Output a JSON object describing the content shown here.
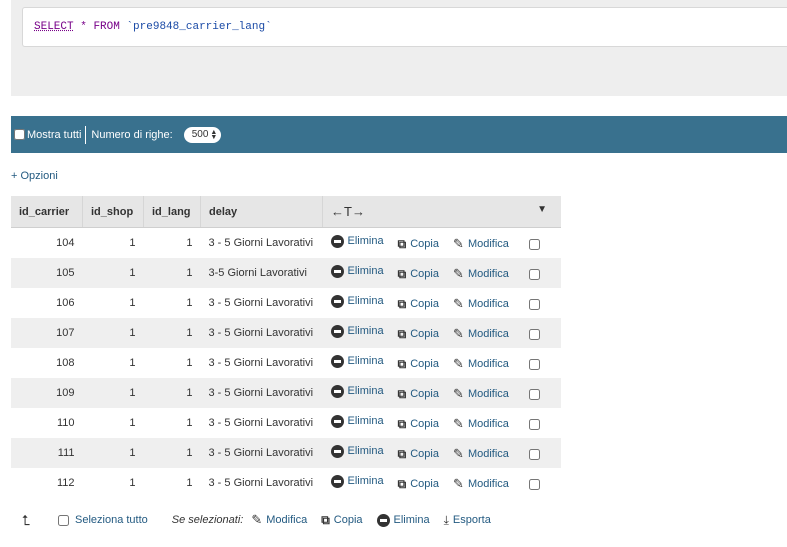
{
  "sql": {
    "select": "SELECT",
    "star": "*",
    "from": "FROM",
    "table": "`pre9848_carrier_lang`"
  },
  "navbar": {
    "show_all": "Mostra tutti",
    "rows_label": "Numero di righe:",
    "rows_value": "500"
  },
  "options_link": "+ Opzioni",
  "table": {
    "columns": [
      "id_carrier",
      "id_shop",
      "id_lang",
      "delay"
    ],
    "resize_glyph": "←T→",
    "sort_glyph": "▼",
    "actions": {
      "delete": "Elimina",
      "copy": "Copia",
      "edit": "Modifica"
    },
    "rows": [
      {
        "id_carrier": "104",
        "id_shop": "1",
        "id_lang": "1",
        "delay": "3 - 5 Giorni Lavorativi"
      },
      {
        "id_carrier": "105",
        "id_shop": "1",
        "id_lang": "1",
        "delay": "3-5 Giorni Lavorativi"
      },
      {
        "id_carrier": "106",
        "id_shop": "1",
        "id_lang": "1",
        "delay": "3 - 5 Giorni Lavorativi"
      },
      {
        "id_carrier": "107",
        "id_shop": "1",
        "id_lang": "1",
        "delay": "3 - 5 Giorni Lavorativi"
      },
      {
        "id_carrier": "108",
        "id_shop": "1",
        "id_lang": "1",
        "delay": "3 - 5 Giorni Lavorativi"
      },
      {
        "id_carrier": "109",
        "id_shop": "1",
        "id_lang": "1",
        "delay": "3 - 5 Giorni Lavorativi"
      },
      {
        "id_carrier": "110",
        "id_shop": "1",
        "id_lang": "1",
        "delay": "3 - 5 Giorni Lavorativi"
      },
      {
        "id_carrier": "111",
        "id_shop": "1",
        "id_lang": "1",
        "delay": "3 - 5 Giorni Lavorativi"
      },
      {
        "id_carrier": "112",
        "id_shop": "1",
        "id_lang": "1",
        "delay": "3 - 5 Giorni Lavorativi"
      }
    ]
  },
  "bottom": {
    "select_all": "Seleziona tutto",
    "with_selected": "Se selezionati:",
    "edit": "Modifica",
    "copy": "Copia",
    "delete": "Elimina",
    "export": "Esporta"
  },
  "icons": {
    "delete": "minus-circle-icon",
    "copy": "copy-icon",
    "edit": "pencil-icon",
    "export": "export-icon",
    "select_all_arrow": "arrow-up-icon"
  }
}
